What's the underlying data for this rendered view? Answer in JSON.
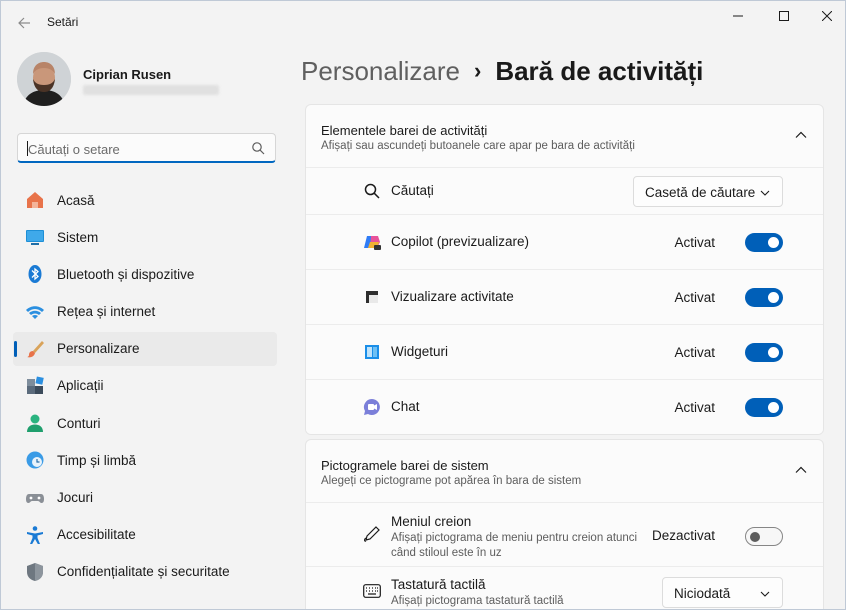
{
  "app": {
    "title": "Setări"
  },
  "profile": {
    "name": "Ciprian Rusen"
  },
  "search": {
    "placeholder": "Căutați o setare"
  },
  "sidebar": {
    "items": [
      {
        "label": "Acasă",
        "icon": "home-icon"
      },
      {
        "label": "Sistem",
        "icon": "system-icon"
      },
      {
        "label": "Bluetooth și dispozitive",
        "icon": "bluetooth-icon"
      },
      {
        "label": "Rețea și internet",
        "icon": "wifi-icon"
      },
      {
        "label": "Personalizare",
        "icon": "brush-icon",
        "active": true
      },
      {
        "label": "Aplicații",
        "icon": "apps-icon"
      },
      {
        "label": "Conturi",
        "icon": "person-icon"
      },
      {
        "label": "Timp și limbă",
        "icon": "clock-globe-icon"
      },
      {
        "label": "Jocuri",
        "icon": "gamepad-icon"
      },
      {
        "label": "Accesibilitate",
        "icon": "accessibility-icon"
      },
      {
        "label": "Confidențialitate și securitate",
        "icon": "shield-icon"
      }
    ]
  },
  "breadcrumb": {
    "parent": "Personalizare",
    "separator": "›",
    "current": "Bară de activități"
  },
  "taskbar_items": {
    "title": "Elementele barei de activități",
    "subtitle": "Afișați sau ascundeți butoanele care apar pe bara de activități",
    "rows": [
      {
        "label": "Căutați",
        "icon": "search-icon",
        "dropdown": "Casetă de căutare"
      },
      {
        "label": "Copilot (previzualizare)",
        "icon": "copilot-icon",
        "state": "Activat",
        "on": true
      },
      {
        "label": "Vizualizare activitate",
        "icon": "task-view-icon",
        "state": "Activat",
        "on": true
      },
      {
        "label": "Widgeturi",
        "icon": "widgets-icon",
        "state": "Activat",
        "on": true
      },
      {
        "label": "Chat",
        "icon": "chat-icon",
        "state": "Activat",
        "on": true
      }
    ]
  },
  "system_tray": {
    "title": "Pictogramele barei de sistem",
    "subtitle": "Alegeți ce pictograme pot apărea în bara de sistem",
    "pen_menu": {
      "label": "Meniul creion",
      "desc_line1": "Afișați pictograma de meniu pentru creion atunci",
      "desc_line2": "când stiloul este în uz",
      "state": "Dezactivat",
      "on": false
    },
    "touch_keyboard": {
      "label": "Tastatură tactilă",
      "desc": "Afișați pictograma tastatură tactilă",
      "dropdown": "Niciodată"
    }
  },
  "colors": {
    "accent": "#005fb8"
  }
}
